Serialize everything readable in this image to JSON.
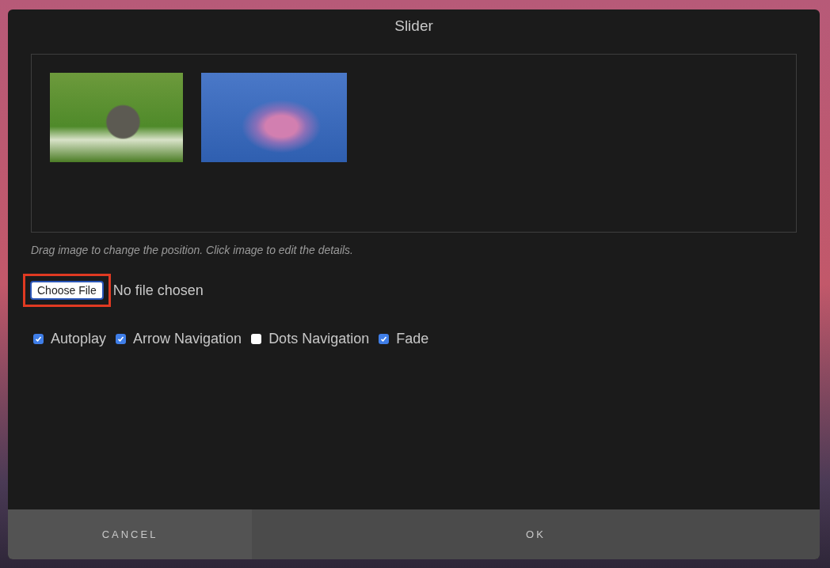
{
  "dialog": {
    "title": "Slider"
  },
  "gallery": {
    "images": [
      {
        "kind": "kitten"
      },
      {
        "kind": "clouds"
      }
    ]
  },
  "hint": "Drag image to change the position. Click image to edit the details.",
  "file_input": {
    "button": "Choose File",
    "status": "No file chosen",
    "highlighted": true
  },
  "options": [
    {
      "label": "Autoplay",
      "checked": true
    },
    {
      "label": "Arrow Navigation",
      "checked": true
    },
    {
      "label": "Dots Navigation",
      "checked": false
    },
    {
      "label": "Fade",
      "checked": true
    }
  ],
  "buttons": [
    {
      "label": "CANCEL",
      "kind": "cancel"
    },
    {
      "label": "OK",
      "kind": "ok"
    }
  ]
}
